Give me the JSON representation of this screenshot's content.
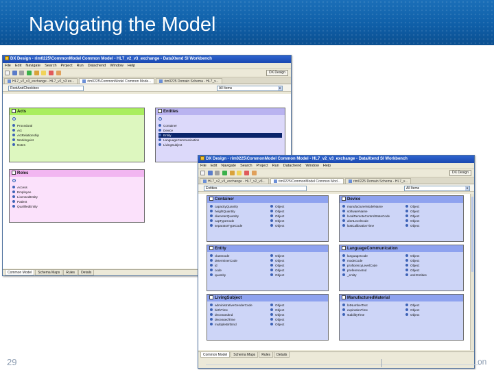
{
  "slide": {
    "title": "Navigating the Model",
    "page_number": "29",
    "footer_fragment": "on"
  },
  "colors": {
    "header_blue": "#0f5fa8",
    "titlebar_blue": "#1a48b0",
    "acts_green": "#a9ee5e",
    "entities_purple": "#b9b3f0",
    "roles_pink": "#f2b6f1",
    "class_blue": "#8ea2ef"
  },
  "back_window": {
    "title": "DX Design - rim0225\\CommonModel Common Model - HL7_v2_v3_exchange - DataXtend SI Workbench",
    "menu": [
      "File",
      "Edit",
      "Navigate",
      "Search",
      "Project",
      "Run",
      "Datachend",
      "Window",
      "Help"
    ],
    "perspective": "DX Design",
    "tabs": [
      "HL7_v2_v3_exchange - HL7_v2_v3 ex...",
      "rim0225\\CommonModel Common Mode...",
      "rim0225 Domain Schema - HL7_v..."
    ],
    "address_value": "RootAndCheckbox",
    "filter_value": "All Items",
    "panels": {
      "acts": {
        "title": "Acts",
        "rows": [
          "Procedural",
          "Act",
          "ActRelationship",
          "WorkingList",
          "Notes"
        ]
      },
      "entities": {
        "title": "Entities",
        "rows": [
          "Container",
          "Device",
          "Entity",
          "LanguageCommunication",
          "LivingSubject"
        ]
      },
      "roles": {
        "title": "Roles",
        "rows": [
          "Access",
          "Employee",
          "LicensedEntity",
          "Patient",
          "QualifiedEntity"
        ]
      }
    },
    "bottom_tabs": [
      "Common Model",
      "Schema Maps",
      "Rules",
      "Details"
    ]
  },
  "front_window": {
    "title": "DX Design - rim0225\\CommonModel Common Model - HL7_v2_v3_exchange - DataXtend SI Workbench",
    "menu": [
      "File",
      "Edit",
      "Navigate",
      "Search",
      "Project",
      "Run",
      "Datachend",
      "Window",
      "Help"
    ],
    "perspective": "DX Design",
    "tabs": [
      "HL7_v2_v3_exchange - HL7_v2_v3...",
      "rim0225\\CommonModel Common Mod...",
      "rim0225 Domain Schema - HL7_v..."
    ],
    "address_value": "Entities",
    "filter_value": "All Items",
    "classes": [
      {
        "title": "Container",
        "rows": [
          [
            "capacityQuantity",
            "Object"
          ],
          [
            "heightQuantity",
            "Object"
          ],
          [
            "diameterQuantity",
            "Object"
          ],
          [
            "capTypeCode",
            "Object"
          ],
          [
            "separatorTypeCode",
            "Object"
          ]
        ]
      },
      {
        "title": "Device",
        "rows": [
          [
            "manufacturerModelName",
            "Object"
          ],
          [
            "softwareName",
            "Object"
          ],
          [
            "localRemoteControlStateCode",
            "Object"
          ],
          [
            "alertLevelCode",
            "Object"
          ],
          [
            "lastCalibrationTime",
            "Object"
          ]
        ]
      },
      {
        "title": "Entity",
        "rows": [
          [
            "classCode",
            "Object"
          ],
          [
            "determinerCode",
            "Object"
          ],
          [
            "id",
            "Object"
          ],
          [
            "code",
            "Object"
          ],
          [
            "quantity",
            "Object"
          ]
        ]
      },
      {
        "title": "LanguageCommunication",
        "rows": [
          [
            "languageCode",
            "Object"
          ],
          [
            "modeCode",
            "Object"
          ],
          [
            "proficiencyLevelCode",
            "Object"
          ],
          [
            "preferenceInd",
            "Object"
          ],
          [
            "_entity",
            "anti:Entities"
          ]
        ]
      },
      {
        "title": "LivingSubject",
        "rows": [
          [
            "administrativeGenderCode",
            "Object"
          ],
          [
            "birthTime",
            "Object"
          ],
          [
            "deceasedInd",
            "Object"
          ],
          [
            "deceasedTime",
            "Object"
          ],
          [
            "multipleBirthInd",
            "Object"
          ]
        ]
      },
      {
        "title": "ManufacturedMaterial",
        "rows": [
          [
            "lotNumberText",
            "Object"
          ],
          [
            "expirationTime",
            "Object"
          ],
          [
            "stabilityTime",
            "Object"
          ]
        ]
      }
    ],
    "bottom_tabs": [
      "Common Model",
      "Schema Maps",
      "Rules",
      "Details"
    ]
  }
}
